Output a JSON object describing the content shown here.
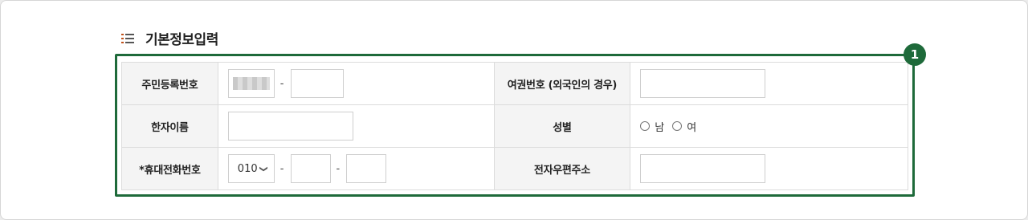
{
  "section": {
    "title": "기본정보입력"
  },
  "marker": {
    "number": "1"
  },
  "accent_color": "#1e6a3a",
  "fields": {
    "resident_number": {
      "label": "주민등록번호",
      "separator": "-",
      "first_part_masked": true,
      "second_part_value": ""
    },
    "passport_number": {
      "label": "여권번호 (외국인의 경우)",
      "value": ""
    },
    "chinese_name": {
      "label": "한자이름",
      "value": ""
    },
    "gender": {
      "label": "성별",
      "options": [
        "남",
        "여"
      ],
      "selected": null
    },
    "mobile_phone": {
      "label": "*휴대전화번호",
      "prefix_selected": "010",
      "separator": "-",
      "middle": "",
      "last": ""
    },
    "postal_code": {
      "label": "전자우편주소",
      "value": ""
    }
  },
  "icons": {
    "title_icon": "list-icon",
    "dropdown_icon": "chevron-down-icon",
    "radio_icon": "radio-circle-icon"
  }
}
